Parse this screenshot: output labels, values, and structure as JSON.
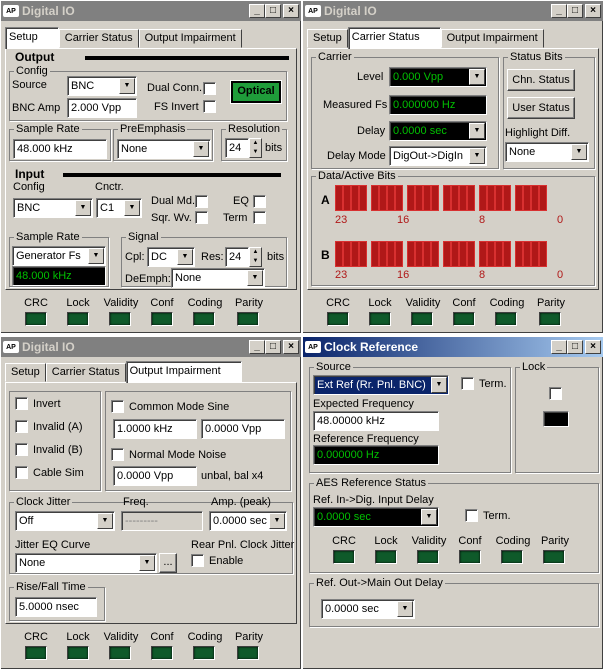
{
  "win1": {
    "title": "Digital IO",
    "tabs": [
      "Setup",
      "Carrier Status",
      "Output Impairment"
    ],
    "output_header": "Output",
    "config_label": "Config",
    "source_label": "Source",
    "source_value": "BNC",
    "dual_conn": "Dual Conn.",
    "optical": "Optical",
    "bnc_amp_label": "BNC Amp",
    "bnc_amp_value": "2.000 Vpp",
    "fs_invert": "FS Invert",
    "sample_rate_label": "Sample Rate",
    "sample_rate_value": "48.000 kHz",
    "preemphasis_label": "PreEmphasis",
    "preemphasis_value": "None",
    "resolution_label": "Resolution",
    "resolution_value": "24",
    "bits": "bits",
    "input_header": "Input",
    "in_config_label": "Config",
    "cnctr_label": "Cnctr.",
    "in_config_value": "BNC",
    "cnctr_value": "C1",
    "dual_md": "Dual Md.",
    "sqr_wv": "Sqr. Wv.",
    "eq": "EQ",
    "term": "Term",
    "in_sample_rate_label": "Sample Rate",
    "in_sample_rate_sel": "Generator Fs",
    "in_sample_rate_value": "48.000 kHz",
    "signal_label": "Signal",
    "cpl_label": "Cpl:",
    "cpl_value": "DC",
    "res_label": "Res:",
    "res_value": "24",
    "bits2": "bits",
    "demph_label": "DeEmph:",
    "demph_value": "None"
  },
  "status_leds": [
    "CRC",
    "Lock",
    "Validity",
    "Conf",
    "Coding",
    "Parity"
  ],
  "win2": {
    "title": "Digital IO",
    "tabs": [
      "Setup",
      "Carrier Status",
      "Output Impairment"
    ],
    "carrier_label": "Carrier",
    "level_label": "Level",
    "level_value": "0.000 Vpp",
    "measured_fs_label": "Measured Fs",
    "measured_fs_value": "0.000000 Hz",
    "delay_label": "Delay",
    "delay_value": "0.0000 sec",
    "delay_mode_label": "Delay Mode",
    "delay_mode_value": "DigOut->DigIn",
    "status_bits_label": "Status Bits",
    "chn_status": "Chn. Status",
    "user_status": "User Status",
    "highlight_diff": "Highlight Diff.",
    "highlight_value": "None",
    "data_bits_label": "Data/Active Bits",
    "row_a": "A",
    "row_b": "B",
    "bit_nums": [
      "23",
      "16",
      "8",
      "0"
    ]
  },
  "win3": {
    "title": "Digital IO",
    "tabs": [
      "Setup",
      "Carrier Status",
      "Output Impairment"
    ],
    "invert": "Invert",
    "invalid_a": "Invalid (A)",
    "invalid_b": "Invalid (B)",
    "cable_sim": "Cable Sim",
    "cm_sine": "Common Mode Sine",
    "cm_freq": "1.0000 kHz",
    "cm_amp": "0.0000 Vpp",
    "nm_noise": "Normal Mode Noise",
    "nm_amp": "0.0000 Vpp",
    "unbal": "unbal, bal x4",
    "clock_jitter": "Clock Jitter",
    "freq": "Freq.",
    "amp_peak": "Amp. (peak)",
    "jitter_value": "Off",
    "freq_value": "---------",
    "amp_value": "0.0000 sec",
    "jitter_eq": "Jitter EQ Curve",
    "jitter_eq_value": "None",
    "ellipsis": "...",
    "rear_pnl": "Rear Pnl. Clock Jitter",
    "enable": "Enable",
    "rise_fall": "Rise/Fall Time",
    "rise_value": "5.0000 nsec"
  },
  "win4": {
    "title": "Clock Reference",
    "source_label": "Source",
    "source_value": "Ext Ref (Rr. Pnl. BNC)",
    "term": "Term.",
    "expected_freq_label": "Expected Frequency",
    "expected_freq_value": "48.00000 kHz",
    "ref_freq_label": "Reference Frequency",
    "ref_freq_value": "0.000000 Hz",
    "lock_label": "Lock",
    "aes_label": "AES Reference Status",
    "ref_in_label": "Ref. In->Dig. Input Delay",
    "ref_in_value": "0.0000 sec",
    "term2": "Term.",
    "ref_out_label": "Ref. Out->Main Out Delay",
    "ref_out_value": "0.0000 sec"
  }
}
